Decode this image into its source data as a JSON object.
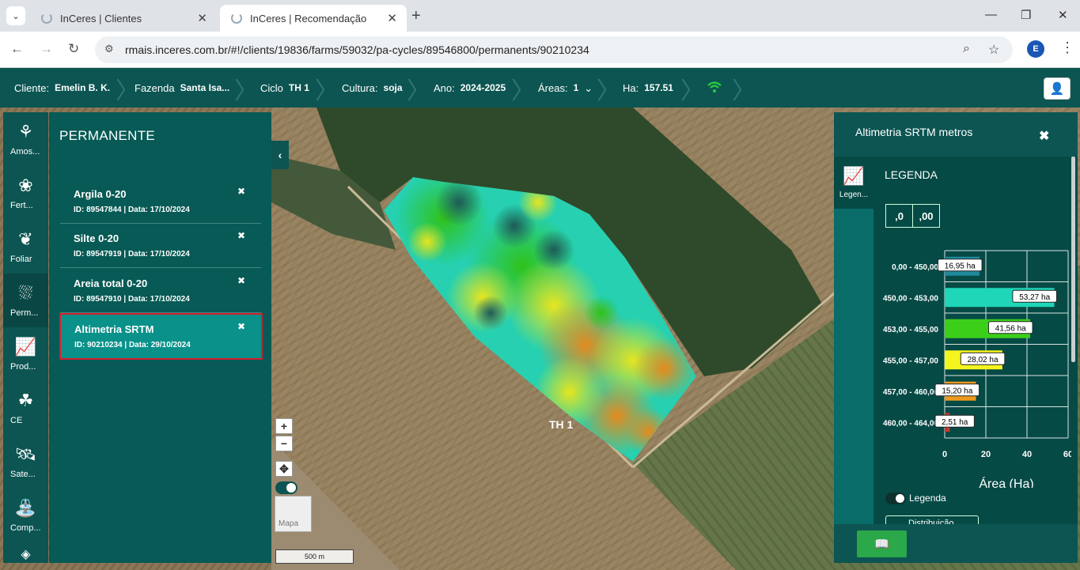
{
  "browser": {
    "tabs": [
      {
        "title": "InCeres | Clientes"
      },
      {
        "title": "InCeres | Recomendação"
      }
    ],
    "url": "rmais.inceres.com.br/#!/clients/19836/farms/59032/pa-cycles/89546800/permanents/90210234",
    "avatar_letter": "E"
  },
  "topbar": {
    "cliente_label": "Cliente:",
    "cliente_value": "Emelin B. K.",
    "fazenda_label": "Fazenda",
    "fazenda_value": "Santa Isa...",
    "ciclo_label": "Ciclo",
    "ciclo_value": "TH 1",
    "cultura_label": "Cultura:",
    "cultura_value": "soja",
    "ano_label": "Ano:",
    "ano_value": "2024-2025",
    "areas_label": "Áreas:",
    "areas_value": "1",
    "ha_label": "Ha:",
    "ha_value": "157.51"
  },
  "iconbar": [
    {
      "label": "Amos...",
      "icon": "sampling-icon"
    },
    {
      "label": "Fert...",
      "icon": "fertilizer-icon"
    },
    {
      "label": "Foliar",
      "icon": "leaf-icon"
    },
    {
      "label": "Perm...",
      "icon": "permanent-icon"
    },
    {
      "label": "Prod...",
      "icon": "productivity-icon"
    },
    {
      "label": "CE",
      "icon": "plant-icon"
    },
    {
      "label": "Sate...",
      "icon": "satellite-icon"
    },
    {
      "label": "Comp...",
      "icon": "compare-icon"
    }
  ],
  "permanent": {
    "title": "PERMANENTE",
    "items": [
      {
        "name": "Argila 0-20",
        "info": "ID: 89547844 | Data: 17/10/2024"
      },
      {
        "name": "Silte 0-20",
        "info": "ID: 89547919 | Data: 17/10/2024"
      },
      {
        "name": "Areia total 0-20",
        "info": "ID: 89547910 | Data: 17/10/2024"
      },
      {
        "name": "Altimetria SRTM",
        "info": "ID: 90210234 | Data: 29/10/2024"
      }
    ],
    "selected_index": 3
  },
  "map": {
    "field_label": "TH 1",
    "thumb_label": "Mapa",
    "scale_label": "500 m"
  },
  "legend_panel": {
    "title": "Altimetria SRTM metros",
    "side_label": "Legen...",
    "legend_title": "LEGENDA",
    "dec_minus": ",0",
    "dec_plus": ",00",
    "toggle_label": "Legenda",
    "dist_label": "Distribuição"
  },
  "chart_data": {
    "type": "bar",
    "orientation": "horizontal",
    "categories": [
      "0,00 - 450,00",
      "450,00 - 453,00",
      "453,00 - 455,00",
      "455,00 - 457,00",
      "457,00 - 460,00",
      "460,00 - 464,00"
    ],
    "values": [
      16.95,
      53.27,
      41.56,
      28.02,
      15.2,
      2.51
    ],
    "data_labels": [
      "16,95 ha",
      "53,27 ha",
      "41,56 ha",
      "28,02 ha",
      "15,20 ha",
      "2,51 ha"
    ],
    "colors": [
      "#1f8a9b",
      "#1fd6b8",
      "#3ccf1a",
      "#f5f51e",
      "#ef9a1d",
      "#c23a2a"
    ],
    "xlabel": "Área (Ha)",
    "xticks": [
      0,
      20,
      40,
      60
    ],
    "xlim": [
      0,
      60
    ],
    "grid": true
  }
}
